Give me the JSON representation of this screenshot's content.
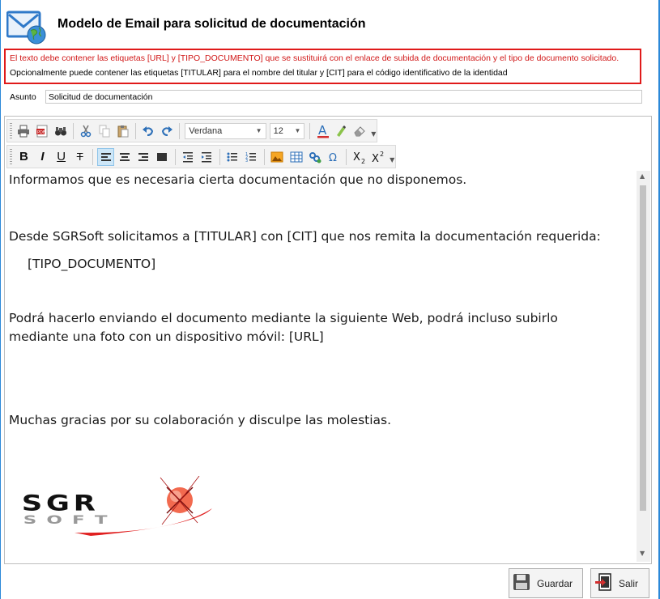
{
  "window": {
    "title": "Modelo de Email para solicitud de documentación"
  },
  "notice": {
    "line1": "El texto debe contener las etiquetas [URL] y [TIPO_DOCUMENTO] que se sustituirá con el enlace de subida de documentación y el tipo de documento solicitado.",
    "line2": "Opcionalmente puede contener las etiquetas [TITULAR] para el nombre del titular y [CIT] para el código identificativo de la identidad",
    "warning_color": "#d11818"
  },
  "subject": {
    "label": "Asunto",
    "value": "Solicitud de documentación"
  },
  "toolbar": {
    "font_family": "Verdana",
    "font_size": "12",
    "row1_icons": [
      "print-icon",
      "pdf-icon",
      "find-icon",
      "cut-icon",
      "copy-icon",
      "paste-icon",
      "undo-icon",
      "redo-icon",
      "font-color-icon",
      "highlight-icon",
      "eraser-icon"
    ],
    "row2_icons": [
      "bold-icon",
      "italic-icon",
      "underline-icon",
      "strikethrough-icon",
      "align-left-icon",
      "align-center-icon",
      "align-right-icon",
      "justify-icon",
      "outdent-icon",
      "indent-icon",
      "bullet-list-icon",
      "numbered-list-icon",
      "insert-image-icon",
      "insert-table-icon",
      "insert-link-icon",
      "special-symbol-icon",
      "subscript-icon",
      "superscript-icon"
    ],
    "bold": "B",
    "italic": "I",
    "underline": "U",
    "strike": "T"
  },
  "body": {
    "p1": "Informamos que es necesaria cierta documentación que no disponemos.",
    "p2": "Desde SGRSoft solicitamos a [TITULAR] con [CIT] que nos remita la documentación requerida:",
    "p3": "[TIPO_DOCUMENTO]",
    "p4a": "Podrá hacerlo enviando el documento mediante la siguiente Web, podrá incluso subirlo",
    "p4b": "mediante una foto con un dispositivo móvil: [URL]",
    "p5": "Muchas gracias por su colaboración y disculpe las molestias.",
    "logo": {
      "top": "SGR",
      "bottom": "SOFT"
    }
  },
  "buttons": {
    "save": "Guardar",
    "exit": "Salir"
  }
}
